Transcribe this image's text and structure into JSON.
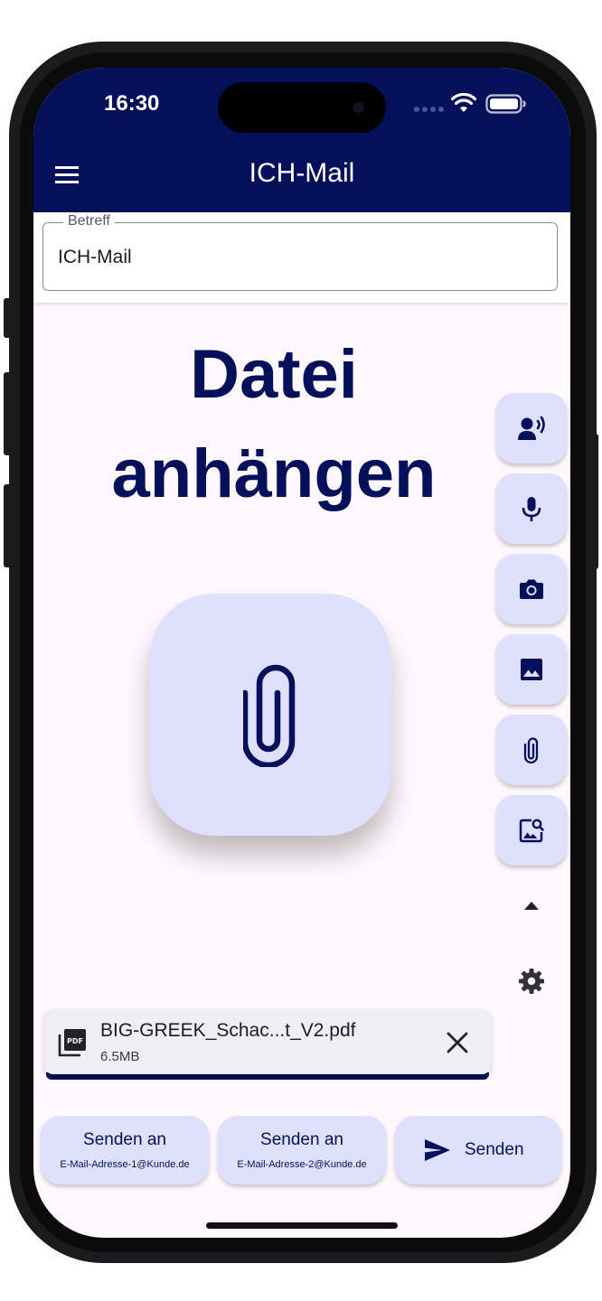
{
  "status_bar": {
    "time": "16:30"
  },
  "app_bar": {
    "title": "ICH-Mail"
  },
  "subject": {
    "label": "Betreff",
    "value": "ICH-Mail"
  },
  "main": {
    "headline_line1": "Datei",
    "headline_line2": "anhängen"
  },
  "side_actions": [
    {
      "icon": "record-voice-icon"
    },
    {
      "icon": "mic-icon"
    },
    {
      "icon": "camera-icon"
    },
    {
      "icon": "image-icon"
    },
    {
      "icon": "attach-icon"
    },
    {
      "icon": "image-search-icon"
    },
    {
      "icon": "arrow-up-icon"
    },
    {
      "icon": "settings-icon"
    }
  ],
  "attachment": {
    "file_name": "BIG-GREEK_Schac...t_V2.pdf",
    "file_size": "6.5MB",
    "type_icon": "pdf-icon"
  },
  "send_buttons": [
    {
      "label": "Senden an",
      "address": "E-Mail-Adresse-1@Kunde.de"
    },
    {
      "label": "Senden an",
      "address": "E-Mail-Adresse-2@Kunde.de"
    }
  ],
  "send": {
    "label": "Senden"
  },
  "colors": {
    "primary": "#04105a",
    "tile": "#dfe1fc",
    "background": "#fff8fc"
  }
}
